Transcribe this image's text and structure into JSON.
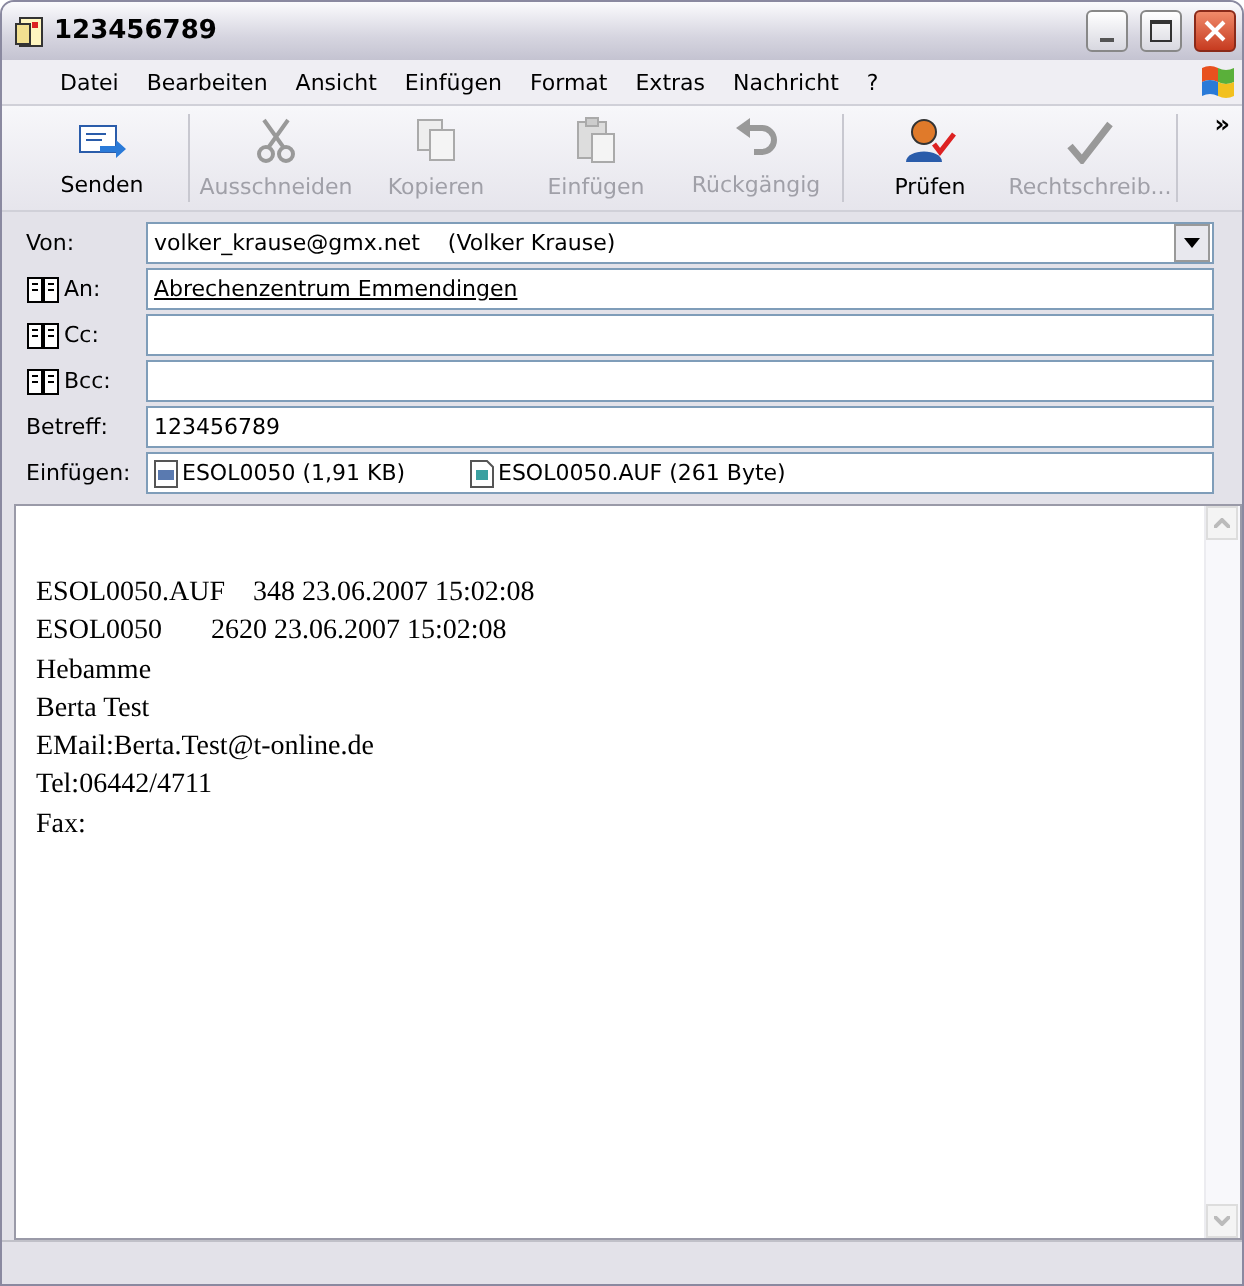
{
  "window": {
    "title": "123456789"
  },
  "menu": [
    "Datei",
    "Bearbeiten",
    "Ansicht",
    "Einfügen",
    "Format",
    "Extras",
    "Nachricht",
    "?"
  ],
  "toolbar": [
    {
      "kind": "send",
      "label": "Senden",
      "disabled": false
    },
    {
      "kind": "cut",
      "label": "Ausschneiden",
      "disabled": true
    },
    {
      "kind": "copy",
      "label": "Kopieren",
      "disabled": true
    },
    {
      "kind": "paste",
      "label": "Einfügen",
      "disabled": true
    },
    {
      "kind": "undo",
      "label": "Rückgängig",
      "disabled": true
    },
    {
      "kind": "check",
      "label": "Prüfen",
      "disabled": false
    },
    {
      "kind": "spell",
      "label": "Rechtschreib...",
      "disabled": true
    }
  ],
  "toolbar_more": "»",
  "from": {
    "label": "Von:",
    "value": "volker_krause@gmx.net    (Volker Krause)"
  },
  "recipients": [
    {
      "label": "An:",
      "value": "Abrechenzentrum Emmendingen"
    },
    {
      "label": "Cc:"
    },
    {
      "label": "Bcc:"
    }
  ],
  "subject": {
    "label": "Betreff:",
    "value": "123456789"
  },
  "attachments": {
    "label": "Einfügen:",
    "items": [
      {
        "kind": "binary",
        "name": "ESOL0050 (1,91 KB)"
      },
      {
        "kind": "text",
        "name": "ESOL0050.AUF (261 Byte)"
      }
    ]
  },
  "body": [
    "ESOL0050.AUF    348 23.06.2007 15:02:08",
    "ESOL0050       2620 23.06.2007 15:02:08",
    "Hebamme",
    "Berta Test",
    "EMail:Berta.Test@t-online.de",
    "Tel:06442/4711",
    "Fax:"
  ]
}
